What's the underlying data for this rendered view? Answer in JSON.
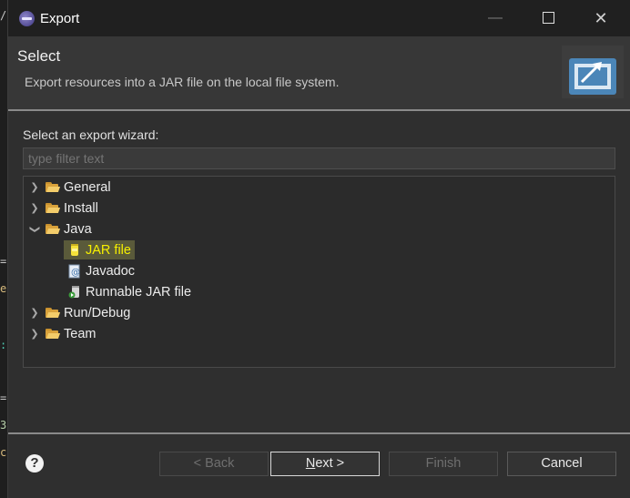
{
  "window": {
    "title": "Export"
  },
  "header": {
    "title": "Select",
    "description": "Export resources into a JAR file on the local file system."
  },
  "wizard": {
    "label": "Select an export wizard:",
    "filter_placeholder": "type filter text",
    "tree": [
      {
        "label": "General",
        "expanded": false
      },
      {
        "label": "Install",
        "expanded": false
      },
      {
        "label": "Java",
        "expanded": true,
        "children": [
          {
            "label": "JAR file",
            "icon": "jar-icon",
            "selected": true
          },
          {
            "label": "Javadoc",
            "icon": "javadoc-icon"
          },
          {
            "label": "Runnable JAR file",
            "icon": "runnable-jar-icon"
          }
        ]
      },
      {
        "label": "Run/Debug",
        "expanded": false
      },
      {
        "label": "Team",
        "expanded": false
      }
    ]
  },
  "buttons": {
    "back": "< Back",
    "next_mnemonic": "N",
    "next_rest": "ext >",
    "finish": "Finish",
    "cancel": "Cancel"
  },
  "help": {
    "glyph": "?"
  },
  "colors": {
    "highlight_text": "#f7f000",
    "background": "#2f2f2f"
  }
}
